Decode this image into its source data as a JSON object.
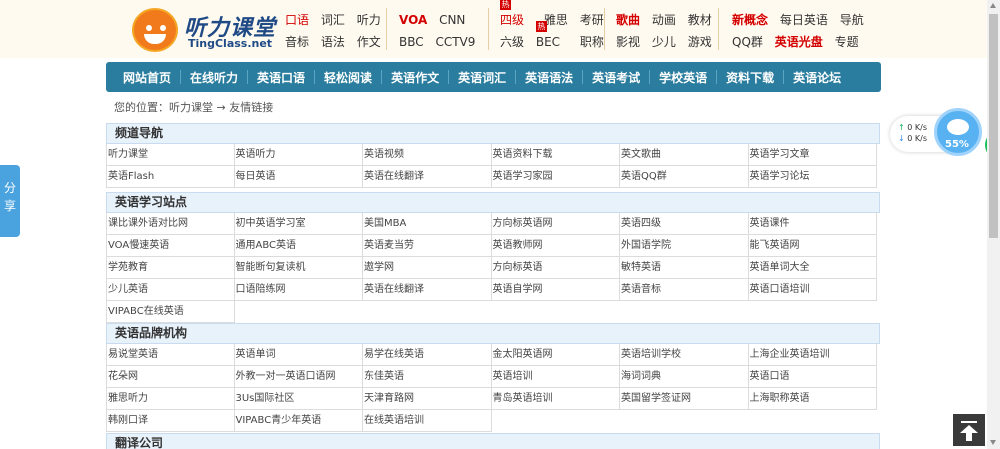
{
  "logo": {
    "cn": "听力课堂",
    "en": "TingClass.net"
  },
  "header_nav": {
    "group1": {
      "row1": [
        "口语",
        "词汇",
        "听力"
      ],
      "row2": [
        "音标",
        "语法",
        "作文"
      ]
    },
    "group2": {
      "row1": [
        "VOA",
        "CNN"
      ],
      "row2": [
        "BBC",
        "CCTV9"
      ]
    },
    "group3": {
      "row1": [
        "四级",
        "雅思",
        "考研"
      ],
      "row2": [
        "六级",
        "BEC",
        "职称"
      ],
      "hot_badge": "热"
    },
    "group4": {
      "row1": [
        "歌曲",
        "动画",
        "教材"
      ],
      "row2": [
        "影视",
        "少儿",
        "游戏"
      ]
    },
    "group5": {
      "row1": [
        "新概念",
        "每日英语",
        "导航"
      ],
      "row2": [
        "QQ群",
        "英语光盘",
        "专题"
      ]
    }
  },
  "main_nav": [
    "网站首页",
    "在线听力",
    "英语口语",
    "轻松阅读",
    "英语作文",
    "英语词汇",
    "英语语法",
    "英语考试",
    "学校英语",
    "资料下载",
    "英语论坛"
  ],
  "breadcrumb": {
    "prefix": "您的位置：",
    "home": "听力课堂",
    "arrow": "→",
    "current": "友情链接"
  },
  "sections": [
    {
      "title": "频道导航",
      "links": [
        "听力课堂",
        "英语听力",
        "英语视频",
        "英语资料下载",
        "英文歌曲",
        "英语学习文章",
        "英语Flash",
        "每日英语",
        "英语在线翻译",
        "英语学习家园",
        "英语QQ群",
        "英语学习论坛"
      ]
    },
    {
      "title": "英语学习站点",
      "links": [
        "课比课外语对比网",
        "初中英语学习室",
        "美国MBA",
        "方向标英语网",
        "英语四级",
        "英语课件",
        "VOA慢速英语",
        "通用ABC英语",
        "英语麦当劳",
        "英语教师网",
        "外国语学院",
        "能飞英语网",
        "学苑教育",
        "智能断句复读机",
        "遨学网",
        "方向标英语",
        "敏特英语",
        "英语单词大全",
        "少儿英语",
        "口语陪练网",
        "英语在线翻译",
        "英语自学网",
        "英语音标",
        "英语口语培训",
        "VIPABC在线英语"
      ]
    },
    {
      "title": "英语品牌机构",
      "links": [
        "易说堂英语",
        "英语单词",
        "易学在线英语",
        "金太阳英语网",
        "英语培训学校",
        "上海企业英语培训",
        "花朵网",
        "外教一对一英语口语网",
        "东佳英语",
        "英语培训",
        "海词词典",
        "英语口语",
        "雅思听力",
        "3Us国际社区",
        "天津育路网",
        "青岛英语培训",
        "英国留学签证网",
        "上海职称英语",
        "韩刚口译",
        "VIPABC青少年英语",
        "在线英语培训"
      ]
    },
    {
      "title": "翻译公司",
      "links": []
    }
  ],
  "share_label": "分享",
  "speed_widget": {
    "up": "↑",
    "down": "↓",
    "up_value": "0",
    "down_value": "0",
    "unit": "K/s",
    "percent": "55%",
    "green_label": "55"
  },
  "colors": {
    "nav_bg": "#2a7d9e",
    "section_head_bg": "#e8f2fb",
    "header_bg": "#fffaf0",
    "accent_red": "#d40000"
  }
}
